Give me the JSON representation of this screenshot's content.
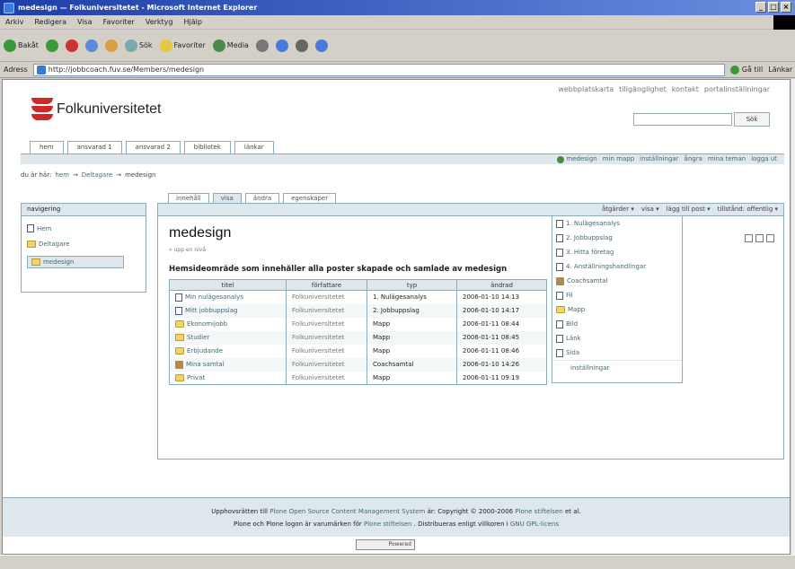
{
  "window": {
    "title": "medesign — Folkuniversitetet - Microsoft Internet Explorer",
    "buttons": [
      "_",
      "□",
      "×"
    ]
  },
  "menubar": [
    "Arkiv",
    "Redigera",
    "Visa",
    "Favoriter",
    "Verktyg",
    "Hjälp"
  ],
  "toolbar": {
    "back": "Bakåt",
    "search": "Sök",
    "favorites": "Favoriter",
    "media": "Media"
  },
  "addressbar": {
    "label": "Adress",
    "url": "http://jobbcoach.fuv.se/Members/medesign",
    "go": "Gå till",
    "links": "Länkar"
  },
  "site_actions": [
    "webbplatskarta",
    "tillgänglighet",
    "kontakt",
    "portalinställningar"
  ],
  "logo": {
    "text": "Folkuniversitetet"
  },
  "search": {
    "button": "Sök"
  },
  "portal_tabs": [
    "hem",
    "ansvarad 1",
    "ansvarad 2",
    "bibliotek",
    "länkar"
  ],
  "personal_bar": [
    "medesign",
    "min mapp",
    "inställningar",
    "ångra",
    "mina teman",
    "logga ut"
  ],
  "breadcrumb": {
    "label": "du är här:",
    "items": [
      "hem",
      "Deltagare",
      "medesign"
    ],
    "sep": "→"
  },
  "nav_portlet": {
    "header": "navigering",
    "items": [
      {
        "label": "Hem",
        "icon": "page"
      },
      {
        "label": "Deltagare",
        "icon": "folder"
      },
      {
        "label": "medesign",
        "icon": "folder"
      }
    ]
  },
  "content_tabs": [
    "innehåll",
    "visa",
    "ändra",
    "egenskaper"
  ],
  "action_bar": [
    "åtgärder ▾",
    "visa ▾",
    "lägg till post ▾",
    "tillstånd: offentlig ▾"
  ],
  "page": {
    "title": "medesign",
    "byline": "» upp en nivå",
    "description": "Hemsideområde som innehåller alla poster skapade och samlade av medesign"
  },
  "listing": {
    "headers": [
      "titel",
      "författare",
      "typ",
      "ändrad"
    ],
    "rows": [
      {
        "icon": "page",
        "title": "Min nulägesanalys",
        "author": "Folkuniversitetet",
        "type": "1. Nulägesanalys",
        "date": "2006-01-10 14:13"
      },
      {
        "icon": "page",
        "title": "Mitt jobbuppslag",
        "author": "Folkuniversitetet",
        "type": "2. Jobbuppslag",
        "date": "2006-01-10 14:17"
      },
      {
        "icon": "folder",
        "title": "Ekonomijobb",
        "author": "Folkuniversitetet",
        "type": "Mapp",
        "date": "2006-01-11 08:44"
      },
      {
        "icon": "folder",
        "title": "Studier",
        "author": "Folkuniversitetet",
        "type": "Mapp",
        "date": "2006-01-11 08:45"
      },
      {
        "icon": "folder",
        "title": "Erbjudande",
        "author": "Folkuniversitetet",
        "type": "Mapp",
        "date": "2006-01-11 08:46"
      },
      {
        "icon": "coach",
        "title": "Mina samtal",
        "author": "Folkuniversitetet",
        "type": "Coachsamtal",
        "date": "2006-01-10 14:26"
      },
      {
        "icon": "folder",
        "title": "Privat",
        "author": "Folkuniversitetet",
        "type": "Mapp",
        "date": "2006-01-11 09:19"
      }
    ]
  },
  "add_menu": {
    "items": [
      {
        "label": "1. Nulägesanalys",
        "icon": "page"
      },
      {
        "label": "2. Jobbuppslag",
        "icon": "page"
      },
      {
        "label": "3. Hitta företag",
        "icon": "page"
      },
      {
        "label": "4. Anställningshandlingar",
        "icon": "page"
      },
      {
        "label": "Coachsamtal",
        "icon": "coach"
      },
      {
        "label": "Fil",
        "icon": "page"
      },
      {
        "label": "Mapp",
        "icon": "folder"
      },
      {
        "label": "Bild",
        "icon": "page"
      },
      {
        "label": "Länk",
        "icon": "page"
      },
      {
        "label": "Sida",
        "icon": "page"
      }
    ],
    "settings": "inställningar"
  },
  "footer": {
    "line1_a": "Upphovsrätten till",
    "line1_link": "Plone Open Source Content Management System",
    "line1_b": "är: Copyright © 2000-2006",
    "line1_link2": "Plone stiftelsen",
    "line1_c": "et al.",
    "line2_a": "Plone och Plone logon är varumärken för",
    "line2_link": "Plone stiftelsen",
    "line2_b": ". Distribueras enligt villkoren i",
    "line2_link2": "GNU GPL-licens",
    "badge": "Powered"
  }
}
